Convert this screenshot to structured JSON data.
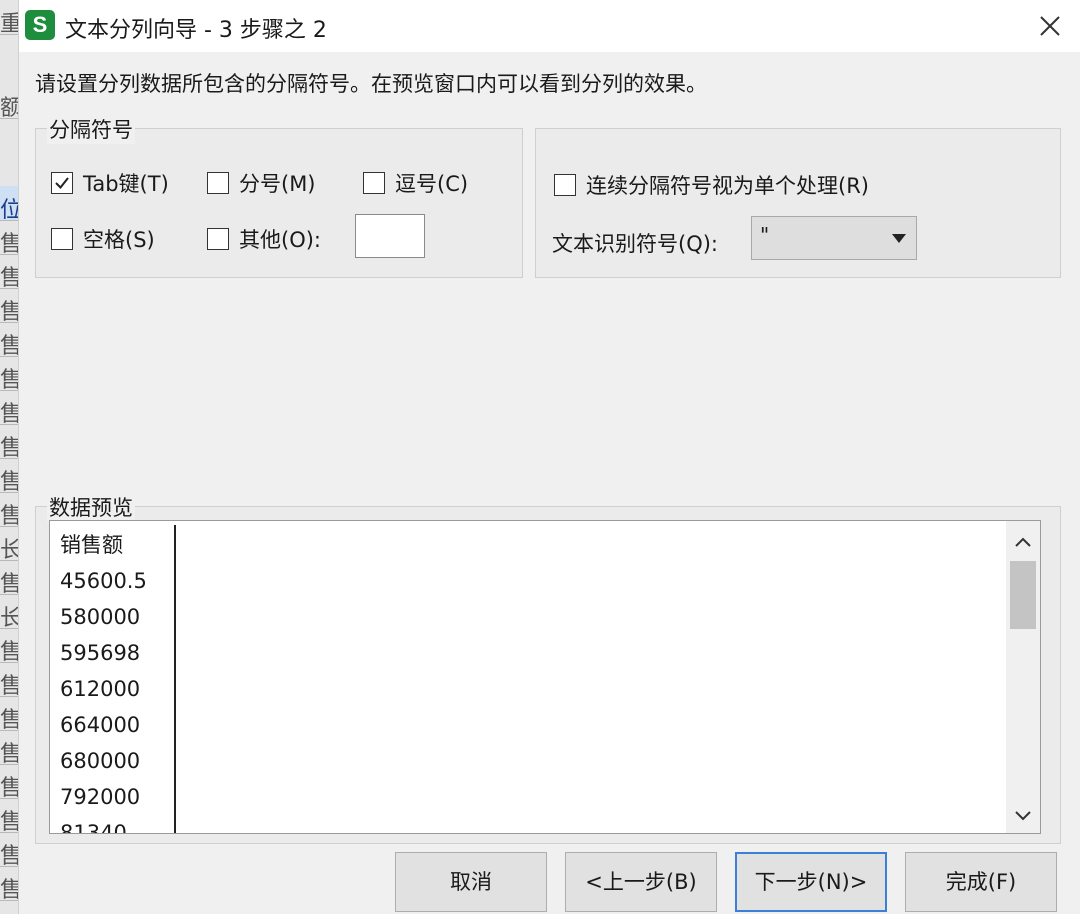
{
  "window": {
    "title": "文本分列向导 - 3 步骤之 2",
    "app_icon_letter": "S",
    "app_icon_color": "#1e8e3e",
    "close_icon": "close-icon"
  },
  "instruction": "请设置分列数据所包含的分隔符号。在预览窗口内可以看到分列的效果。",
  "delimiters": {
    "legend": "分隔符号",
    "options": [
      {
        "label": "Tab键(T)",
        "checked": true
      },
      {
        "label": "分号(M)",
        "checked": false
      },
      {
        "label": "逗号(C)",
        "checked": false
      },
      {
        "label": "空格(S)",
        "checked": false
      },
      {
        "label": "其他(O):",
        "checked": false
      }
    ],
    "other_value": ""
  },
  "options_panel": {
    "consecutive_label": "连续分隔符号视为单个处理(R)",
    "consecutive_checked": false,
    "text_qualifier_label": "文本识别符号(Q):",
    "text_qualifier_value": "\""
  },
  "preview": {
    "legend": "数据预览",
    "rows": [
      "销售额",
      "45600.5",
      "580000",
      "595698",
      "612000",
      "664000",
      "680000",
      "792000",
      "81340"
    ]
  },
  "buttons": {
    "cancel": "取消",
    "back": "<上一步(B)",
    "next": "下一步(N)>",
    "finish": "完成(F)"
  },
  "background_app": {
    "visible_chars": [
      "重",
      "额",
      "位",
      "售",
      "售",
      "售",
      "售",
      "售",
      "售",
      "售",
      "售",
      "售",
      "长",
      "售",
      "长",
      "售",
      "售",
      "售",
      "售",
      "售",
      "售",
      "售",
      "售",
      "售",
      "长"
    ]
  }
}
